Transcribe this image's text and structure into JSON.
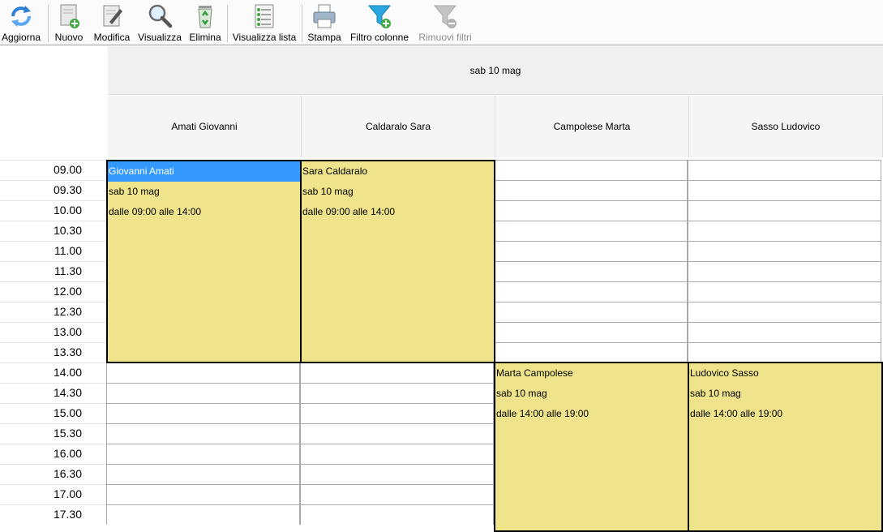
{
  "toolbar": {
    "buttons": [
      {
        "label": "Aggiorna",
        "icon": "refresh-icon",
        "enabled": true
      },
      {
        "label": "Nuovo",
        "icon": "new-document-icon",
        "enabled": true
      },
      {
        "label": "Modifica",
        "icon": "edit-document-icon",
        "enabled": true
      },
      {
        "label": "Visualizza",
        "icon": "magnifier-icon",
        "enabled": true
      },
      {
        "label": "Elimina",
        "icon": "recycle-bin-icon",
        "enabled": true
      },
      {
        "label": "Visualizza lista",
        "icon": "list-icon",
        "enabled": true
      },
      {
        "label": "Stampa",
        "icon": "printer-icon",
        "enabled": true
      },
      {
        "label": "Filtro colonne",
        "icon": "filter-add-icon",
        "enabled": true
      },
      {
        "label": "Rimuovi filtri",
        "icon": "filter-remove-icon",
        "enabled": false
      }
    ]
  },
  "scheduler": {
    "date": "sab 10 mag",
    "resources": [
      "Amati Giovanni",
      "Caldaralo Sara",
      "Campolese Marta",
      "Sasso Ludovico"
    ],
    "times": [
      "09.00",
      "09.30",
      "10.00",
      "10.30",
      "11.00",
      "11.30",
      "12.00",
      "12.30",
      "13.00",
      "13.30",
      "14.00",
      "14.30",
      "15.00",
      "15.30",
      "16.00",
      "16.30",
      "17.00",
      "17.30"
    ],
    "appointments": [
      {
        "title": "Giovanni Amati",
        "date": "sab 10 mag",
        "range": "dalle 09:00 alle 14:00",
        "selected": true
      },
      {
        "title": "Sara Caldaralo",
        "date": "sab 10 mag",
        "range": "dalle 09:00 alle 14:00",
        "selected": false
      },
      {
        "title": "Marta Campolese",
        "date": "sab 10 mag",
        "range": "dalle 14:00 alle 19:00",
        "selected": false
      },
      {
        "title": "Ludovico Sasso",
        "date": "sab 10 mag",
        "range": "dalle 14:00 alle 19:00",
        "selected": false
      }
    ],
    "colors": {
      "appointment": "#efe48b",
      "selection": "#3399ff"
    }
  }
}
